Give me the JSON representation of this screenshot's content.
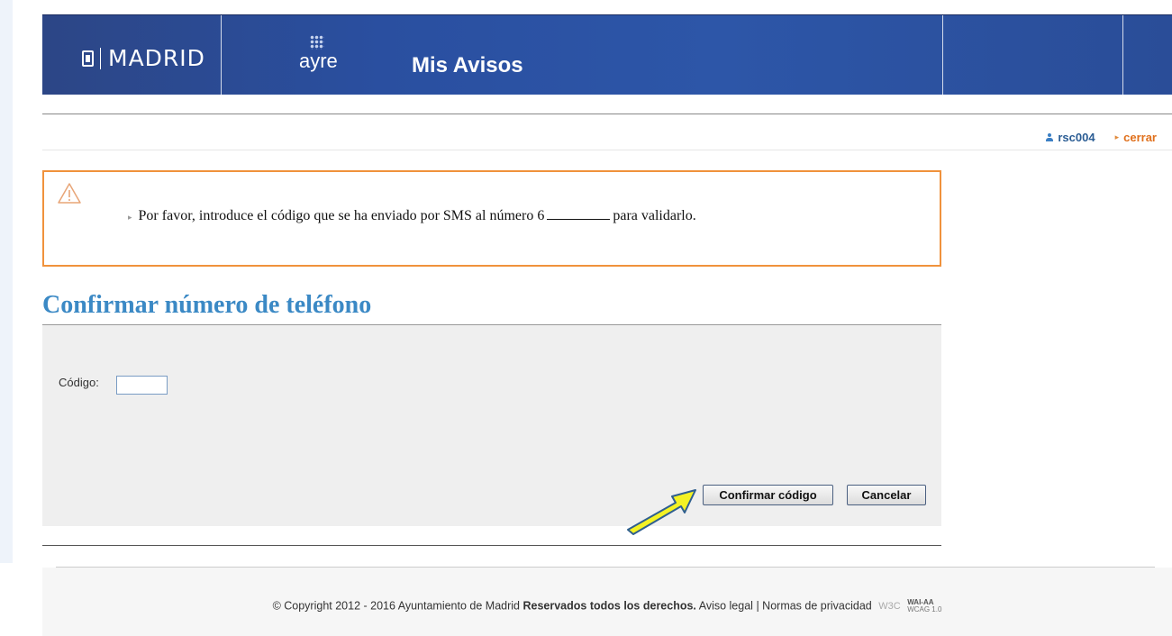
{
  "header": {
    "city_name": "MADRID",
    "ayre_logo": "ayre",
    "app_title": "Mis Avisos"
  },
  "user_bar": {
    "username": "rsc004",
    "logout_label": "cerrar"
  },
  "alert": {
    "message_before": "Por favor, introduce el código que se ha enviado por SMS al número 6",
    "message_after": "para validarlo."
  },
  "form": {
    "title": "Confirmar número de teléfono",
    "code_label": "Código:",
    "code_value": "",
    "confirm_button": "Confirmar código",
    "cancel_button": "Cancelar"
  },
  "footer": {
    "copyright": "© Copyright 2012 - 2016 Ayuntamiento de Madrid",
    "rights": "Reservados todos los derechos.",
    "legal_link": "Aviso legal",
    "divider": "|",
    "privacy_link": "Normas de privacidad",
    "w3c_badge": "W3C",
    "wai_badge": "WAI-AA",
    "wcag_badge": "WCAG 1.0"
  },
  "colors": {
    "banner_blue": "#2a4fa0",
    "title_blue": "#3b89c5",
    "alert_orange": "#f0923c",
    "annotation_yellow": "#f4f224"
  }
}
